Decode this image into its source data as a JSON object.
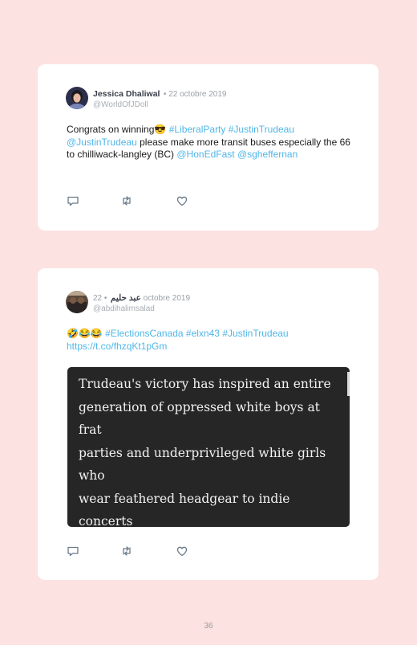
{
  "tweets": [
    {
      "name": "Jessica Dhaliwal",
      "date": "22 octobre 2019",
      "handle": "@WorldOfJDoll",
      "text": [
        {
          "t": "Congrats on winning😎 ",
          "link": false
        },
        {
          "t": "#LiberalParty",
          "link": true
        },
        {
          "t": " ",
          "link": false
        },
        {
          "t": "#JustinTrudeau",
          "link": true
        },
        {
          "t": " ",
          "link": false
        },
        {
          "t": "@JustinTrudeau",
          "link": true
        },
        {
          "t": " please make more transit buses especially the 66 to chilliwack-langley (BC) ",
          "link": false
        },
        {
          "t": "@HonEdFast",
          "link": true
        },
        {
          "t": " ",
          "link": false
        },
        {
          "t": "@sgheffernan",
          "link": true
        }
      ]
    },
    {
      "name": "عبد حليم",
      "date": "22 octobre 2019",
      "handle": "@abdihalimsalad",
      "text": [
        {
          "t": "🤣😂😂 ",
          "link": false
        },
        {
          "t": "#ElectionsCanada",
          "link": true
        },
        {
          "t": " ",
          "link": false
        },
        {
          "t": "#elxn43",
          "link": true
        },
        {
          "t": " ",
          "link": false
        },
        {
          "t": "#JustinTrudeau",
          "link": true
        },
        {
          "t": " https://t.co/fhzqKt1pGm",
          "link": true
        }
      ],
      "image_text": "Trudeau's victory has inspired an entire\ngeneration of oppressed white boys at frat\nparties and underprivileged white girls who\nwear feathered headgear to indie concerts\nin hopes that they too may be elected as\nPrime Minister without any real\nconsequences."
    }
  ],
  "actions": [
    "reply-icon",
    "retweet-icon",
    "like-icon"
  ],
  "colors": {
    "background": "#fde2e2",
    "link": "#50b6e8",
    "icon": "#6a7a89"
  },
  "page_number": "36"
}
